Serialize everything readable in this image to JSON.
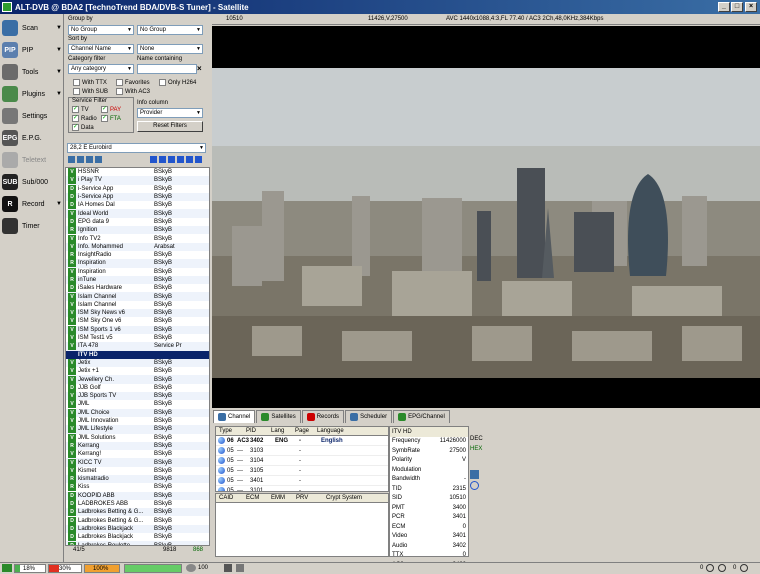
{
  "window": {
    "title": "ALT-DVB @ BDA2 [TechnoTrend BDA/DVB-S Tuner] - Satellite",
    "min": "_",
    "max": "□",
    "close": "×"
  },
  "leftbar": [
    {
      "label": "Scan",
      "icon": "scan-icon",
      "color": "#3a6ea5"
    },
    {
      "label": "PIP",
      "icon": "pip-icon",
      "color": "#5b7fae"
    },
    {
      "label": "Tools",
      "icon": "tools-icon",
      "color": "#6b6b6b"
    },
    {
      "label": "Plugins",
      "icon": "plugins-icon",
      "color": "#4a8a4a"
    },
    {
      "label": "Settings",
      "icon": "settings-icon",
      "color": "#777"
    },
    {
      "label": "E.P.G.",
      "icon": "epg-icon",
      "color": "#555"
    },
    {
      "label": "Teletext",
      "icon": "teletext-icon",
      "color": "#aaa"
    },
    {
      "label": "Sub/000",
      "icon": "subtitles-icon",
      "color": "#222"
    },
    {
      "label": "Record",
      "icon": "record-icon",
      "color": "#111"
    },
    {
      "label": "Timer",
      "icon": "timer-icon",
      "color": "#333"
    }
  ],
  "icon_text": {
    "pip": "PIP",
    "epg": "EPG",
    "sub": "SUB",
    "record": "R"
  },
  "filters": {
    "group_by": "Group by",
    "group1": "No Group",
    "group2": "No Group",
    "sort_by": "Sort by",
    "sort1": "Channel Name",
    "sort2": "None",
    "cat_filter": "Category filter",
    "name_containing": "Name containing",
    "cat_value": "Any category",
    "clear": "×",
    "with_ttx": "With TTX",
    "favorites": "Favorites",
    "only_h264": "Only H264",
    "with_sub": "With SUB",
    "with_ac3": "With AC3",
    "service_filter": "Service Filter",
    "tv": "TV",
    "pay": "PAY",
    "radio": "Radio",
    "fta": "FTA",
    "data": "Data",
    "info_column": "Info column",
    "info_value": "Provider",
    "reset": "Reset Filters",
    "check": "✓"
  },
  "satellite": "28,2 E Eurobird",
  "channels": [
    [
      "V",
      "HSSNR",
      "BSkyB"
    ],
    [
      "V",
      "i Play TV",
      "BSkyB"
    ],
    [
      "D",
      "i-Service App",
      "BSkyB"
    ],
    [
      "D",
      "i-Service App",
      "BSkyB"
    ],
    [
      "D",
      "IA Homes Dal",
      "BSkyB"
    ],
    [
      "V",
      "Ideal World",
      "BSkyB"
    ],
    [
      "D",
      "EPG data 9",
      "BSkyB"
    ],
    [
      "R",
      "Ignition",
      "BSkyB"
    ],
    [
      "V",
      "Info TV2",
      "BSkyB"
    ],
    [
      "V",
      "Info. Mohammed",
      "Arabsat"
    ],
    [
      "R",
      "InsightRadio",
      "BSkyB"
    ],
    [
      "R",
      "Inspiration",
      "BSkyB"
    ],
    [
      "V",
      "Inspiration",
      "BSkyB"
    ],
    [
      "R",
      "inTune",
      "BSkyB"
    ],
    [
      "D",
      "iSales Hardware",
      "BSkyB"
    ],
    [
      "V",
      "Islam Channel",
      "BSkyB"
    ],
    [
      "V",
      "Islam Channel",
      "BSkyB"
    ],
    [
      "V",
      "ISM Sky News v6",
      "BSkyB"
    ],
    [
      "V",
      "ISM Sky One v6",
      "BSkyB"
    ],
    [
      "V",
      "ISM Sports 1 v6",
      "BSkyB"
    ],
    [
      "V",
      "ISM Test1 v5",
      "BSkyB"
    ],
    [
      "V",
      "ITA 478",
      "Service Pr"
    ],
    [
      "G",
      "ITV HD",
      ""
    ],
    [
      "V",
      "Jetix",
      "BSkyB"
    ],
    [
      "V",
      "Jetix +1",
      "BSkyB"
    ],
    [
      "V",
      "Jewellery Ch.",
      "BSkyB"
    ],
    [
      "D",
      "JJB Golf",
      "BSkyB"
    ],
    [
      "V",
      "JJB Sports TV",
      "BSkyB"
    ],
    [
      "V",
      "JML",
      "BSkyB"
    ],
    [
      "V",
      "JML Choice",
      "BSkyB"
    ],
    [
      "V",
      "JML Innovation",
      "BSkyB"
    ],
    [
      "V",
      "JML Lifestyle",
      "BSkyB"
    ],
    [
      "V",
      "JML Solutions",
      "BSkyB"
    ],
    [
      "R",
      "Kerrang",
      "BSkyB"
    ],
    [
      "V",
      "Kerrang!",
      "BSkyB"
    ],
    [
      "V",
      "KICC TV",
      "BSkyB"
    ],
    [
      "V",
      "Kismet",
      "BSkyB"
    ],
    [
      "R",
      "kismatradio",
      "BSkyB"
    ],
    [
      "R",
      "Kiss",
      "BSkyB"
    ],
    [
      "D",
      "KOOPID ABB",
      "BSkyB"
    ],
    [
      "D",
      "LADBROKES ABB",
      "BSkyB"
    ],
    [
      "D",
      "Ladbrokes Betting & G...",
      "BSkyB"
    ],
    [
      "D",
      "Ladbrokes Betting & G...",
      "BSkyB"
    ],
    [
      "D",
      "Ladbrokes Blackjack",
      "BSkyB"
    ],
    [
      "D",
      "Ladbrokes Blackjack",
      "BSkyB"
    ],
    [
      "D",
      "Ladbrokes Roulette",
      "BSkyB"
    ]
  ],
  "chstatus": {
    "left": "41/5",
    "count": "9818",
    "right": "868"
  },
  "topinfo": {
    "sid": "10510",
    "tp": "11426,V,27500",
    "video": "AVC 1440x1088,4:3,FL 77.40 / AC3 2Ch,48,0KHz,384Kbps"
  },
  "tabs": [
    "Channel",
    "Satellites",
    "Records",
    "Scheduler",
    "EPG/Channel"
  ],
  "pid_headers": [
    "Type",
    "PID",
    "Lang",
    "Page",
    "Language"
  ],
  "pids": [
    [
      "06",
      "AC3",
      "3402",
      "ENG",
      "-",
      "English"
    ],
    [
      "05",
      "---",
      "3103",
      "",
      "-",
      ""
    ],
    [
      "05",
      "---",
      "3104",
      "",
      "-",
      ""
    ],
    [
      "05",
      "---",
      "3105",
      "",
      "-",
      ""
    ],
    [
      "05",
      "---",
      "3401",
      "",
      "-",
      ""
    ],
    [
      "05",
      "---",
      "3101",
      "",
      "-",
      ""
    ]
  ],
  "ca_headers": [
    "CAID",
    "ECM",
    "EMM",
    "PRV",
    "Crypt System"
  ],
  "info": {
    "title": "ITV HD",
    "rows": [
      [
        "Frequency",
        "11426000"
      ],
      [
        "SymbRate",
        "27500"
      ],
      [
        "Polarity",
        "V"
      ],
      [
        "Modulation",
        ""
      ],
      [
        "Bandwidth",
        "-"
      ],
      [
        "TID",
        "2315"
      ],
      [
        "SID",
        "10510"
      ],
      [
        "PMT",
        "3400"
      ],
      [
        "PCR",
        "3401"
      ],
      [
        "ECM",
        "0"
      ],
      [
        "Video",
        "3401"
      ],
      [
        "Audio",
        "3402"
      ],
      [
        "TTX",
        "0"
      ],
      [
        "AC3",
        "3402"
      ]
    ],
    "dec": "DEC",
    "hex": "HEX"
  },
  "bottom": {
    "signal": "18%",
    "quality": "30%",
    "level": "100%",
    "vol": "100",
    "zoom_l": "0",
    "zoom_r": "0"
  },
  "colors": {
    "tv": "#2a8a2a",
    "radio": "#2a8a2a",
    "data": "#2a8a2a",
    "group": "#0a246a"
  }
}
